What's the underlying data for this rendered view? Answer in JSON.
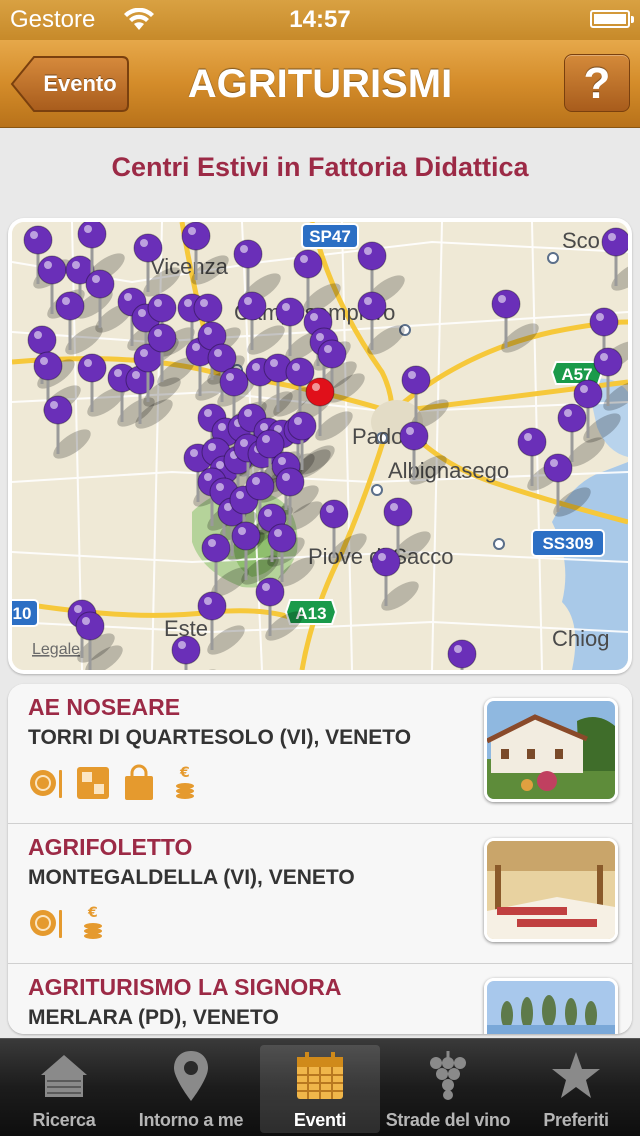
{
  "status_bar": {
    "carrier": "Gestore",
    "time": "14:57"
  },
  "nav": {
    "back_label": "Evento",
    "title": "AGRITURISMI",
    "help_label": "?"
  },
  "subtitle": "Centri Estivi in Fattoria Didattica",
  "map": {
    "labels": {
      "vicenza": "Vicenza",
      "camposampiero": "Camposampiero",
      "padova": "Padova",
      "albignasego": "Albignasego",
      "piove": "Piove di Sacco",
      "este": "Este",
      "chioggia": "Chiog",
      "sco": "Sco",
      "legal": "Legale"
    },
    "road_shields": {
      "sp47": "SP47",
      "a57": "A57",
      "ss309": "SS309",
      "a13": "A13",
      "a10": "10"
    }
  },
  "list": [
    {
      "name": "AE NOSEARE",
      "location": "TORRI DI QUARTESOLO (VI), VENETO",
      "icons": [
        "restaurant-icon",
        "rooms-icon",
        "shop-bag-icon",
        "euro-coins-icon"
      ]
    },
    {
      "name": "AGRIFOLETTO",
      "location": "MONTEGALDELLA (VI), VENETO",
      "icons": [
        "restaurant-icon",
        "euro-coins-icon"
      ]
    },
    {
      "name": "AGRITURISMO LA SIGNORA",
      "location": "MERLARA (PD), VENETO",
      "icons": []
    }
  ],
  "tabs": [
    {
      "label": "Ricerca",
      "icon": "farmhouse-icon",
      "active": false
    },
    {
      "label": "Intorno a me",
      "icon": "location-pin-icon",
      "active": false
    },
    {
      "label": "Eventi",
      "icon": "calendar-icon",
      "active": true
    },
    {
      "label": "Strade del vino",
      "icon": "grapes-icon",
      "active": false
    },
    {
      "label": "Preferiti",
      "icon": "star-icon",
      "active": false
    }
  ],
  "colors": {
    "accent": "#d48c2a",
    "title_red": "#9c2a46",
    "pin_purple": "#6a2fb8",
    "pin_red": "#e0101a",
    "icon_orange": "#e59a2e"
  }
}
